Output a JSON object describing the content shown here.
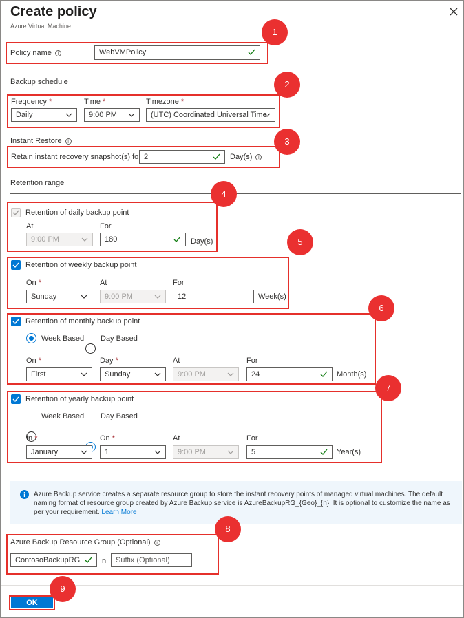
{
  "header": {
    "title": "Create policy",
    "subtitle": "Azure Virtual Machine"
  },
  "callouts": [
    "1",
    "2",
    "3",
    "4",
    "5",
    "6",
    "7",
    "8",
    "9"
  ],
  "policy_name": {
    "label": "Policy name",
    "value": "WebVMPolicy"
  },
  "backup_schedule": {
    "heading": "Backup schedule",
    "frequency_label": "Frequency",
    "frequency_value": "Daily",
    "time_label": "Time",
    "time_value": "9:00 PM",
    "timezone_label": "Timezone",
    "timezone_value": "(UTC) Coordinated Universal Time"
  },
  "instant_restore": {
    "heading": "Instant Restore",
    "retain_label": "Retain instant recovery snapshot(s) for",
    "retain_value": "2",
    "unit": "Day(s)"
  },
  "retention_range": {
    "heading": "Retention range",
    "daily": {
      "label": "Retention of daily backup point",
      "at_label": "At",
      "at_value": "9:00 PM",
      "for_label": "For",
      "for_value": "180",
      "unit": "Day(s)"
    },
    "weekly": {
      "label": "Retention of weekly backup point",
      "on_label": "On",
      "on_value": "Sunday",
      "at_label": "At",
      "at_value": "9:00 PM",
      "for_label": "For",
      "for_value": "12",
      "unit": "Week(s)"
    },
    "monthly": {
      "label": "Retention of monthly backup point",
      "radio_week": "Week Based",
      "radio_day": "Day Based",
      "on_label": "On",
      "on_value": "First",
      "day_label": "Day",
      "day_value": "Sunday",
      "at_label": "At",
      "at_value": "9:00 PM",
      "for_label": "For",
      "for_value": "24",
      "unit": "Month(s)"
    },
    "yearly": {
      "label": "Retention of yearly backup point",
      "radio_week": "Week Based",
      "radio_day": "Day Based",
      "in_label": "In",
      "in_value": "January",
      "on_label": "On",
      "on_value": "1",
      "at_label": "At",
      "at_value": "9:00 PM",
      "for_label": "For",
      "for_value": "5",
      "unit": "Year(s)"
    }
  },
  "info_banner": {
    "text": "Azure Backup service creates a separate resource group to store the instant recovery points of managed virtual machines. The default naming format of resource group created by Azure Backup service is AzureBackupRG_{Geo}_{n}. It is optional to customize the name as per your requirement.",
    "link": "Learn More"
  },
  "resource_group": {
    "label": "Azure Backup Resource Group (Optional)",
    "value": "ContosoBackupRG",
    "separator": "n",
    "suffix_placeholder": "Suffix (Optional)"
  },
  "footer": {
    "ok_label": "OK"
  },
  "colors": {
    "accent": "#0078d4",
    "callout": "#ea3030",
    "highlight_border": "#e5302b",
    "info_background": "#eff6fc"
  }
}
